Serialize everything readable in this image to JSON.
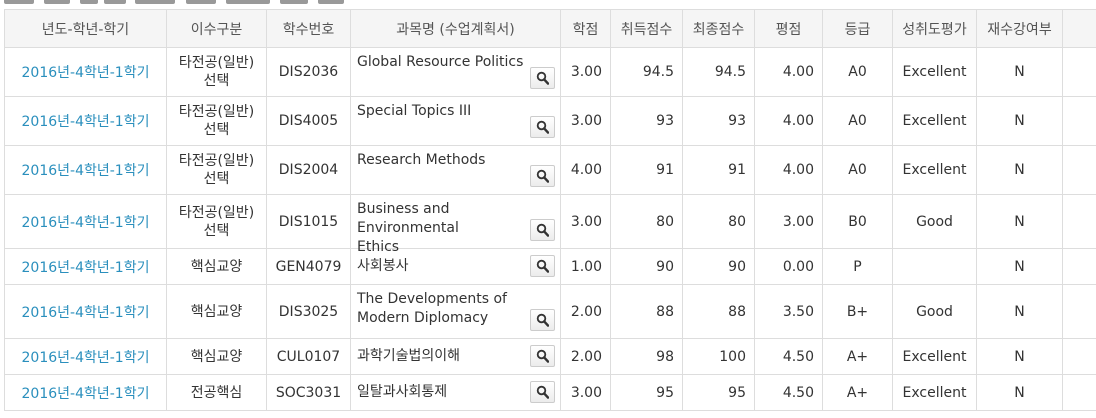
{
  "headers": [
    "년도-학년-학기",
    "이수구분",
    "학수번호",
    "과목명 (수업계획서)",
    "학점",
    "취득점수",
    "최종점수",
    "평점",
    "등급",
    "성취도평가",
    "재수강여부"
  ],
  "rows": [
    {
      "term": "2016년-4학년-1학기",
      "cat1": "타전공(일반)",
      "cat2": "선택",
      "code": "DIS2036",
      "title1": "Global Resource Politics",
      "title2": "",
      "credits": "3.00",
      "earned": "94.5",
      "final": "94.5",
      "gpa": "4.00",
      "grade": "A0",
      "achieve": "Excellent",
      "retake": "N"
    },
    {
      "term": "2016년-4학년-1학기",
      "cat1": "타전공(일반)",
      "cat2": "선택",
      "code": "DIS4005",
      "title1": "Special Topics III",
      "title2": "",
      "credits": "3.00",
      "earned": "93",
      "final": "93",
      "gpa": "4.00",
      "grade": "A0",
      "achieve": "Excellent",
      "retake": "N"
    },
    {
      "term": "2016년-4학년-1학기",
      "cat1": "타전공(일반)",
      "cat2": "선택",
      "code": "DIS2004",
      "title1": "Research Methods",
      "title2": "",
      "credits": "4.00",
      "earned": "91",
      "final": "91",
      "gpa": "4.00",
      "grade": "A0",
      "achieve": "Excellent",
      "retake": "N"
    },
    {
      "term": "2016년-4학년-1학기",
      "cat1": "타전공(일반)",
      "cat2": "선택",
      "code": "DIS1015",
      "title1": "Business and Environmental",
      "title2": "Ethics",
      "credits": "3.00",
      "earned": "80",
      "final": "80",
      "gpa": "3.00",
      "grade": "B0",
      "achieve": "Good",
      "retake": "N"
    },
    {
      "term": "2016년-4학년-1학기",
      "cat1": "핵심교양",
      "cat2": "",
      "code": "GEN4079",
      "title1": "사회봉사",
      "title2": "",
      "credits": "1.00",
      "earned": "90",
      "final": "90",
      "gpa": "0.00",
      "grade": "P",
      "achieve": "",
      "retake": "N"
    },
    {
      "term": "2016년-4학년-1학기",
      "cat1": "핵심교양",
      "cat2": "",
      "code": "DIS3025",
      "title1": "The Developments of",
      "title2": "Modern Diplomacy",
      "credits": "2.00",
      "earned": "88",
      "final": "88",
      "gpa": "3.50",
      "grade": "B+",
      "achieve": "Good",
      "retake": "N"
    },
    {
      "term": "2016년-4학년-1학기",
      "cat1": "핵심교양",
      "cat2": "",
      "code": "CUL0107",
      "title1": "과학기술법의이해",
      "title2": "",
      "credits": "2.00",
      "earned": "98",
      "final": "100",
      "gpa": "4.50",
      "grade": "A+",
      "achieve": "Excellent",
      "retake": "N"
    },
    {
      "term": "2016년-4학년-1학기",
      "cat1": "전공핵심",
      "cat2": "",
      "code": "SOC3031",
      "title1": "일탈과사회통제",
      "title2": "",
      "credits": "3.00",
      "earned": "95",
      "final": "95",
      "gpa": "4.50",
      "grade": "A+",
      "achieve": "Excellent",
      "retake": "N"
    }
  ],
  "icons": {
    "syllabus_button": "search-icon"
  }
}
